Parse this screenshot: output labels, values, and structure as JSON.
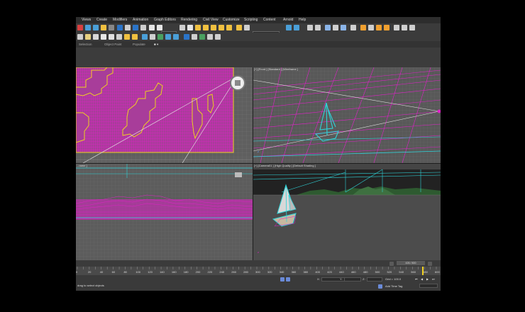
{
  "menubar": {
    "items": [
      "Views",
      "Create",
      "Modifiers",
      "Animation",
      "Graph Editors",
      "Rendering",
      "Civil View",
      "Customize",
      "Scripting",
      "Content",
      "Arnold",
      "Help"
    ]
  },
  "toolbar": {
    "view_combo": "View",
    "selection_set": "Create Selection Se"
  },
  "ribbon": {
    "tabs": [
      "Selection",
      "Object Paint",
      "Populate"
    ]
  },
  "viewports": {
    "front_label": "[+] [Front ] [Standard ] [Wireframe ]",
    "bottom_left_label": "...rame ]",
    "camera_label": "[+] [Camera01 ] [High Quality ] [Default Shading ]"
  },
  "timeline": {
    "frame_counter": "426 / 800",
    "ticks": [
      "0",
      "10",
      "20",
      "30",
      "40",
      "50",
      "60",
      "70",
      "80",
      "90",
      "100",
      "110",
      "120",
      "130",
      "140",
      "150",
      "160",
      "170",
      "180",
      "190",
      "200",
      "210",
      "220",
      "230",
      "240",
      "250",
      "260",
      "270",
      "280",
      "290",
      "300",
      "310",
      "320",
      "330",
      "340",
      "350",
      "360",
      "370",
      "380",
      "390",
      "400",
      "410",
      "420",
      "430",
      "440",
      "450",
      "460",
      "470",
      "480",
      "490",
      "500",
      "510",
      "520",
      "530",
      "540",
      "550",
      "560",
      "570",
      "580",
      "590",
      "600"
    ]
  },
  "status": {
    "prompt": "drag to select objects",
    "x_label": "X:",
    "y_label": "Y:",
    "z_label": "Z:",
    "grid": "Grid = 100.0",
    "add_time_tag": "Add Time Tag"
  },
  "colors": {
    "wire_magenta": "#e020c8",
    "wire_cyan": "#2fd3d8",
    "highlight_yellow": "#f0d020",
    "boat_white": "#e6ffff"
  }
}
